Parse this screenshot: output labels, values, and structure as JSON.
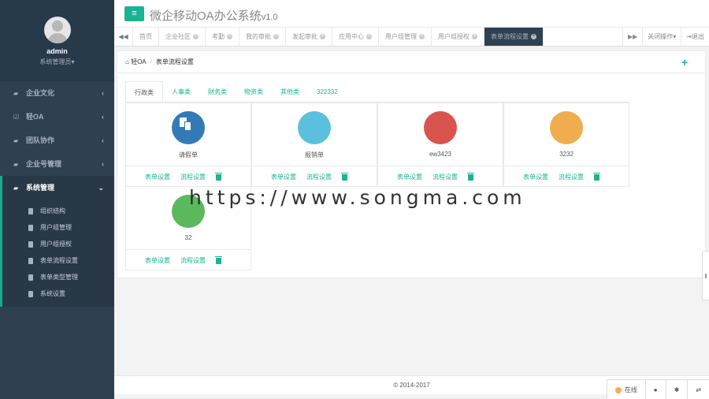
{
  "profile": {
    "name": "admin",
    "role": "系统管理员▾"
  },
  "sidebar": {
    "items": [
      {
        "label": "企业文化",
        "icon": "folder-icon"
      },
      {
        "label": "轻OA",
        "icon": "check-square-icon"
      },
      {
        "label": "团队协作",
        "icon": "folder-icon"
      },
      {
        "label": "企业号管理",
        "icon": "folder-icon"
      },
      {
        "label": "系统管理",
        "icon": "folder-open-icon"
      }
    ],
    "sub_items": [
      "组织结构",
      "用户组管理",
      "用户组授权",
      "表单流程设置",
      "表单类型管理",
      "系统设置"
    ]
  },
  "header": {
    "title": "微企移动OA办公系统",
    "version": "v1.0"
  },
  "tabs": [
    {
      "label": "首页",
      "closable": false
    },
    {
      "label": "企业社区",
      "closable": true
    },
    {
      "label": "考勤",
      "closable": true
    },
    {
      "label": "我的审批",
      "closable": true
    },
    {
      "label": "发起审批",
      "closable": true
    },
    {
      "label": "应用中心",
      "closable": true
    },
    {
      "label": "用户组管理",
      "closable": true
    },
    {
      "label": "用户组授权",
      "closable": true
    },
    {
      "label": "表单流程设置",
      "closable": true
    }
  ],
  "tab_controls": {
    "close_ops": "关闭操作▾",
    "logout": "退出"
  },
  "breadcrumb": {
    "home": "轻OA",
    "current": "表单流程设置"
  },
  "categories": [
    "行政类",
    "人事类",
    "财务类",
    "物资类",
    "其他类",
    "322332"
  ],
  "cards": [
    {
      "label": "请假单",
      "color": "#337ab7"
    },
    {
      "label": "报销单",
      "color": "#5bc0de"
    },
    {
      "label": "ew3423",
      "color": "#d9534f"
    },
    {
      "label": "3232",
      "color": "#f0ad4e"
    },
    {
      "label": "32",
      "color": "#5cb85c"
    }
  ],
  "card_actions": {
    "form": "表单设置",
    "flow": "流程设置"
  },
  "watermark": "https://www.songma.com",
  "footer": "© 2014-2017",
  "bottom": {
    "status": "在线"
  }
}
